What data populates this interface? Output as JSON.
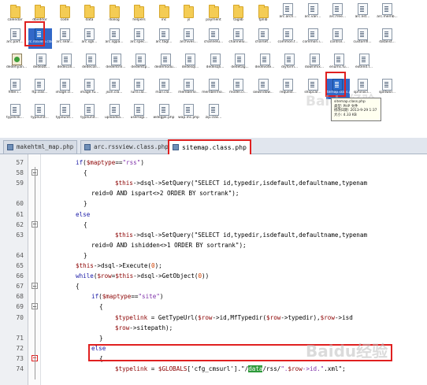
{
  "explorer": {
    "rows": [
      {
        "type": "folder",
        "items": [
          "calendar",
          "dbeditor",
          "code",
          "data",
          "dialog",
          "helpers",
          "inc",
          "js",
          "payment",
          "taglib",
          "tpllib",
          "arc.arch...",
          "arc.vari...",
          "arc.free...",
          "arc.list...",
          "arc.memb..."
        ]
      },
      {
        "type": "file",
        "items": [
          "arc.part...",
          "arc.rssview.class.php",
          "arc.sear...",
          "arc.sgli...",
          "arc.sgpa...",
          "arc.spec...",
          "arc.tagl...",
          "archives...",
          "channelu...",
          "channelu...",
          "charset...",
          "common.f...",
          "common.i...",
          "control...",
          "customfi...",
          "datalist..."
        ]
      },
      {
        "type": "file",
        "items": [
          "dedehyan...",
          "dedeatt...",
          "dedecoll...",
          "dedecoll...",
          "dedehtml...",
          "dedehttp...",
          "dedemodu...",
          "dedesql...",
          "dedesqli...",
          "dedetag...",
          "dedevote...",
          "diyform...",
          "downmix...",
          "enums.fu...",
          "extend.f..."
        ]
      },
      {
        "type": "file",
        "items": [
          "filter.i...",
          "ftp.clas...",
          "image.cl...",
          "image.fu...",
          "json.cla...",
          "lurd.cla...",
          "mail.cla...",
          "memberlo...",
          "membermo...",
          "model.cl...",
          "oxwindow...",
          "request...",
          "shopcar...",
          "sitemap.class.php",
          "sphinxcl...",
          "splitwor..."
        ]
      },
      {
        "type": "file",
        "items": [
          "typelink...",
          "typeunit...",
          "typeunit...",
          "typeunit...",
          "uploadsa...",
          "userlogi...",
          "wdegpk.php",
          "wap.inc.php",
          "zip.clas..."
        ]
      }
    ],
    "first_row_icons": [
      "folder-icon",
      "file-icon"
    ],
    "tooltip": {
      "line1": "sitemap.class.php",
      "line2": "类型: PHP 文件",
      "line3": "修改日期: 2013-9-29 1:37",
      "line4": "大小: 4.33 KB"
    },
    "watermark": "Baidu经验"
  },
  "editor": {
    "tabs": [
      {
        "label": "makehtml_map.php",
        "active": false
      },
      {
        "label": "arc.rssview.class.php",
        "active": false
      },
      {
        "label": "sitemap.class.php",
        "active": true
      }
    ],
    "watermark": "Baidu经验",
    "lines": [
      {
        "no": "57",
        "text": "if($maptype==\"rss\")"
      },
      {
        "no": "58",
        "text": "{"
      },
      {
        "no": "59",
        "text": "$this->dsql->SetQuery(\"SELECT id,typedir,isdefault,defaultname,typenam"
      },
      {
        "no": "",
        "text": "reid=0 AND ispart<>2 ORDER BY sortrank\");"
      },
      {
        "no": "60",
        "text": "}"
      },
      {
        "no": "61",
        "text": "else"
      },
      {
        "no": "62",
        "text": "{"
      },
      {
        "no": "63",
        "text": "$this->dsql->SetQuery(\"SELECT id,typedir,isdefault,defaultname,typenam"
      },
      {
        "no": "",
        "text": "reid=0 AND ishidden<>1 ORDER BY sortrank\");"
      },
      {
        "no": "64",
        "text": "}"
      },
      {
        "no": "65",
        "text": "$this->dsql->Execute(0);"
      },
      {
        "no": "66",
        "text": "while($row=$this->dsql->GetObject(0))"
      },
      {
        "no": "67",
        "text": "{"
      },
      {
        "no": "68",
        "text": "if($maptype==\"site\")"
      },
      {
        "no": "69",
        "text": "{"
      },
      {
        "no": "70",
        "text": "$typelink = GetTypeUrl($row->id,MfTypedir($row->typedir),$row->isd"
      },
      {
        "no": "",
        "text": "$row->sitepath);"
      },
      {
        "no": "71",
        "text": "}"
      },
      {
        "no": "72",
        "text": "else"
      },
      {
        "no": "73",
        "text": "{"
      },
      {
        "no": "74",
        "text": "$typelink = $GLOBALS['cfg_cmsurl'].\"/data/rss/\".$row->id.\".xml\";"
      }
    ],
    "line74": {
      "before": "$typelink = $GLOBALS['cfg_cmsurl'].\"/",
      "highlight": "data",
      "after": "/rss/\".$row->id.\".xml\";"
    },
    "highlight_color": "#e02020"
  }
}
